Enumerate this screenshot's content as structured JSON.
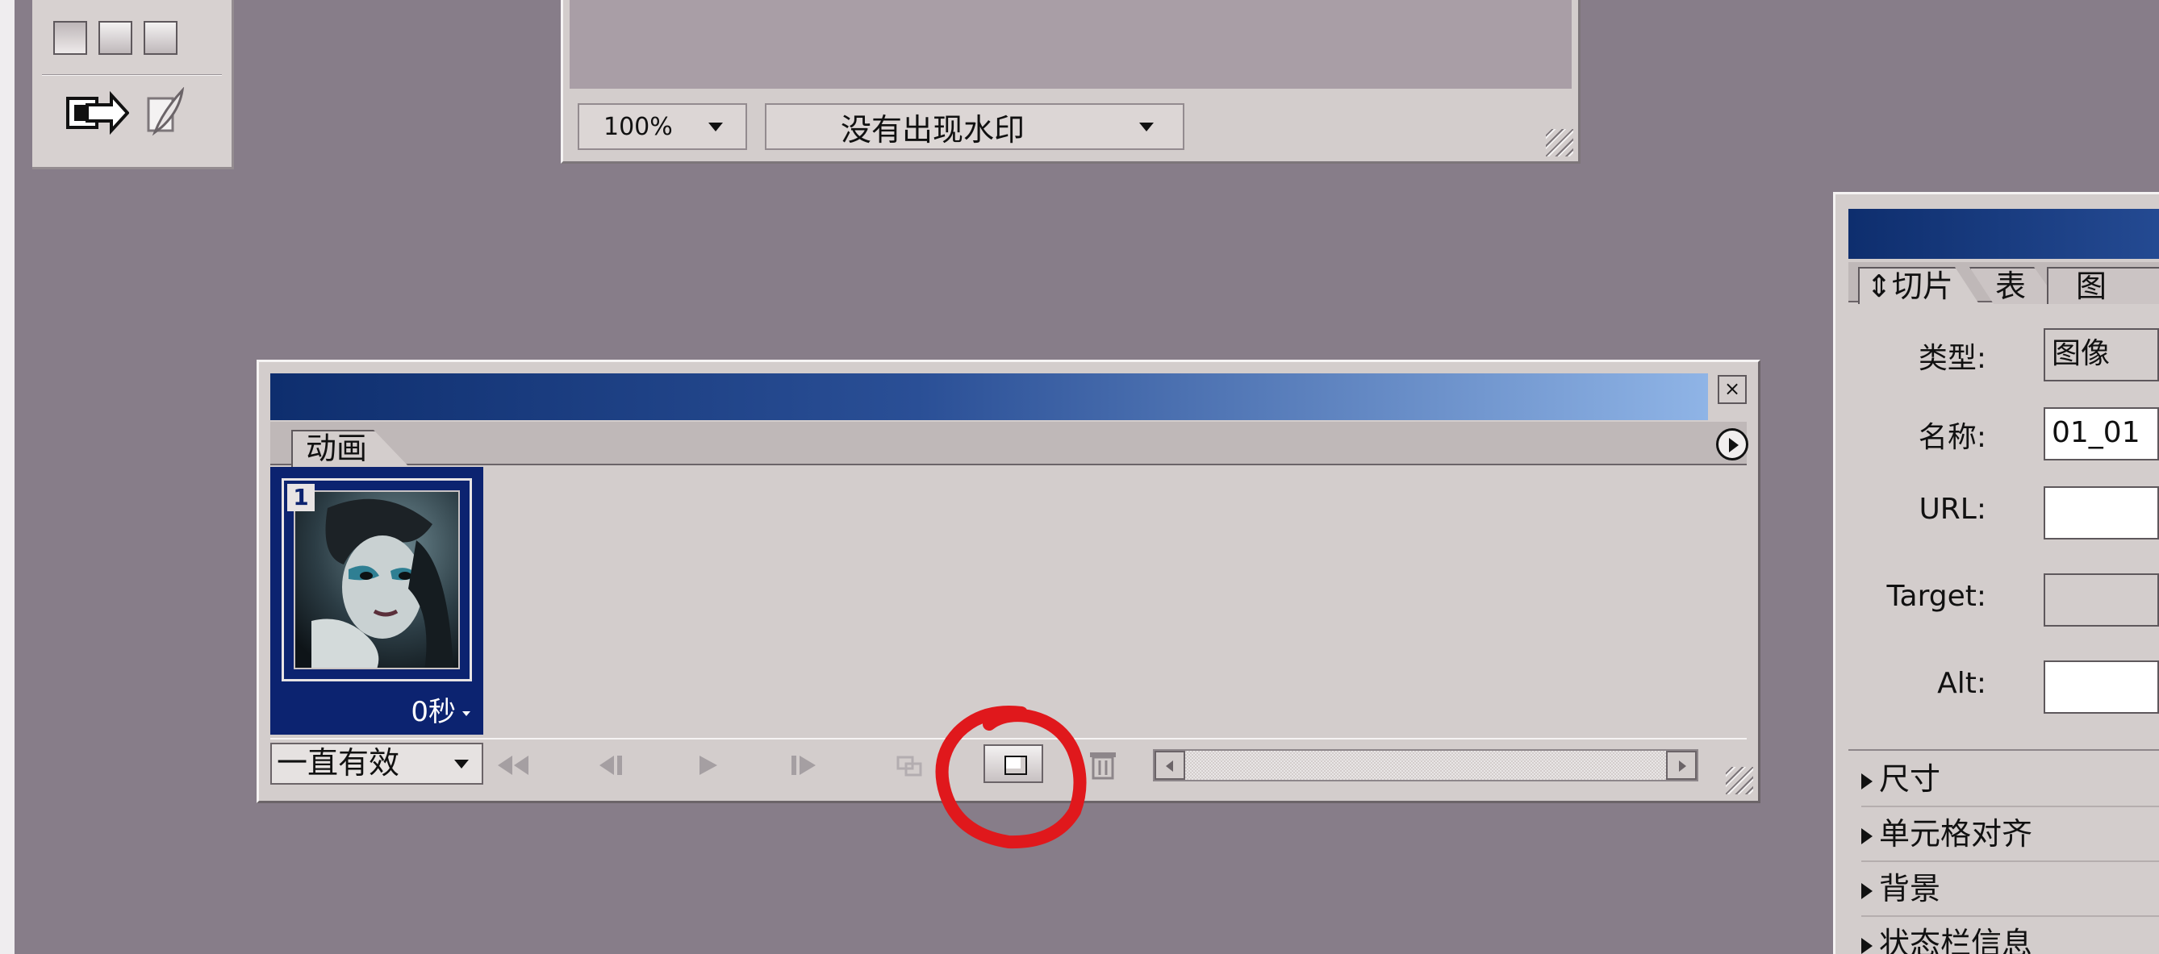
{
  "image_window": {
    "zoom_value": "100%",
    "watermark_status": "没有出现水印"
  },
  "animation_palette": {
    "tab_label": "动画",
    "close_glyph": "×",
    "frames": [
      {
        "number": "1",
        "delay": "0秒"
      }
    ],
    "loop_option": "一直有效"
  },
  "slice_panel": {
    "tabs": [
      "切片",
      "表",
      "图"
    ],
    "fields": {
      "type_label": "类型:",
      "type_value": "图像",
      "name_label": "名称:",
      "name_value": "01_01",
      "url_label": "URL:",
      "url_value": "",
      "target_label": "Target:",
      "target_value": "",
      "alt_label": "Alt:",
      "alt_value": ""
    },
    "sections": [
      "尺寸",
      "单元格对齐",
      "背景",
      "状态栏信息"
    ]
  },
  "colors": {
    "desktop": "#877d89",
    "panel": "#d3cdcc",
    "selection": "#0c2370",
    "annotation": "#e0181c"
  },
  "icons": [
    "standard-mode-icon",
    "full-screen-icon",
    "jump-to-imageready-icon",
    "feather-icon",
    "first-frame-icon",
    "prev-frame-icon",
    "play-icon",
    "next-frame-icon",
    "tween-icon",
    "duplicate-frame-icon",
    "trash-icon",
    "palette-menu-icon",
    "resize-grip-icon"
  ]
}
